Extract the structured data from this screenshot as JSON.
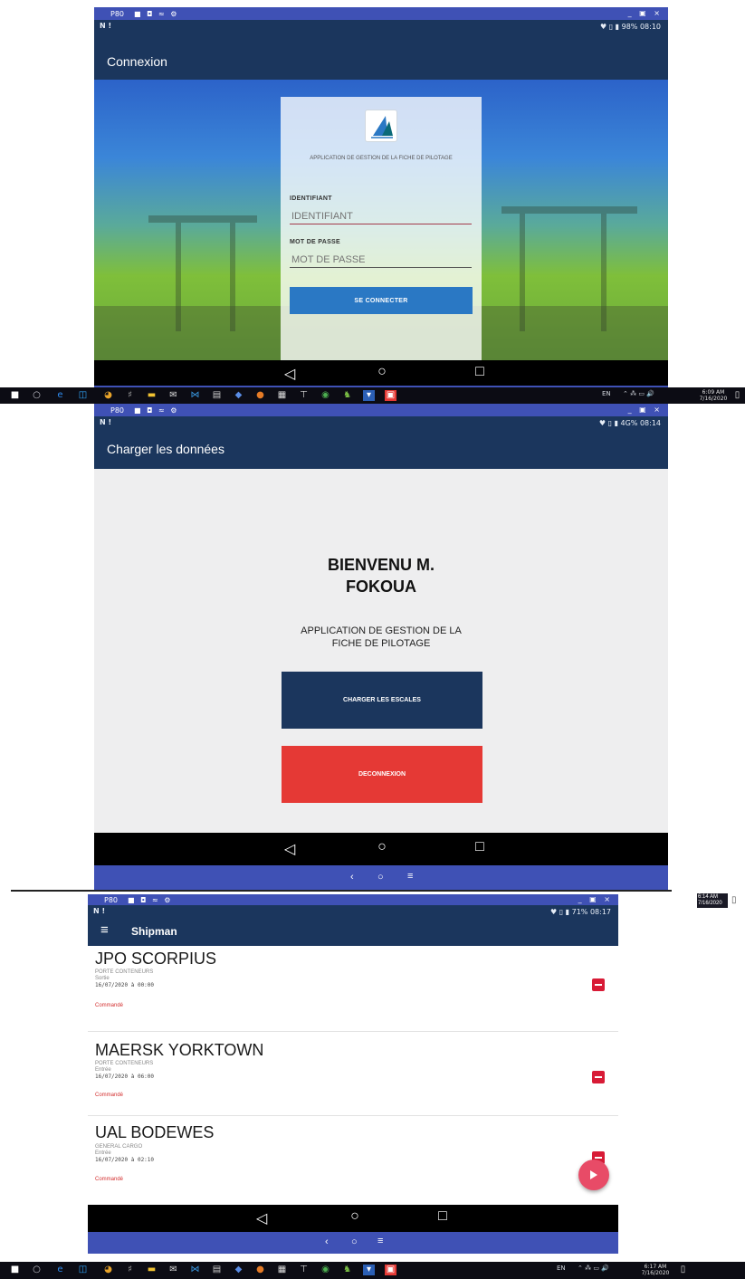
{
  "emulator": {
    "label": "P80",
    "tools": "■ ◘ ≈ ⚙",
    "controls": "_ ▣ ×"
  },
  "status": {
    "left": "N !",
    "right_1": "♥ ▯ ▮ 98% 08:10",
    "right_2": "♥ ▯ ▮ 4G% 08:14",
    "right_3": "♥ ▯ ▮ 71% 08:17"
  },
  "nav_icons": {
    "back": "◁",
    "home": "○",
    "recents": "□",
    "emu_back": "‹",
    "emu_home": "○",
    "emu_menu": "≡"
  },
  "login": {
    "appbar_title": "Connexion",
    "app_name": "APPLICATION DE GESTION DE LA FICHE DE PILOTAGE",
    "id_label": "IDENTIFIANT",
    "id_placeholder": "IDENTIFIANT",
    "pw_label": "MOT DE PASSE",
    "pw_placeholder": "MOT DE PASSE",
    "connect_button": "SE CONNECTER"
  },
  "welcome": {
    "appbar_title": "Charger les données",
    "greeting_line1": "BIENVENU M.",
    "greeting_line2": "FOKOUA",
    "app_line1": "APPLICATION DE GESTION DE LA",
    "app_line2": "FICHE DE PILOTAGE",
    "load_button": "CHARGER LES ESCALES",
    "logout_button": "DECONNEXION"
  },
  "shipman": {
    "appbar_title": "Shipman",
    "ships": [
      {
        "name": "JPO SCORPIUS",
        "type": "PORTE CONTENEURS",
        "movement": "Sortie",
        "date": "16/07/2020 à 00:00",
        "status": "Commandé"
      },
      {
        "name": "MAERSK YORKTOWN",
        "type": "PORTE CONTENEURS",
        "movement": "Entrée",
        "date": "16/07/2020 à 06:00",
        "status": "Commandé"
      },
      {
        "name": "UAL BODEWES",
        "type": "GENERAL CARGO",
        "movement": "Entrée",
        "date": "16/07/2020 à 02:10",
        "status": "Commandé"
      }
    ]
  },
  "taskbar": {
    "lang": "EN",
    "tray": "⌃ ⁂ ▭ 🔊",
    "time1": "6:09 AM",
    "date1": "7/16/2020",
    "time2": "6:14 AM",
    "date2": "7/16/2020",
    "time3": "6:17 AM",
    "date3": "7/16/2020"
  },
  "colors": {
    "primary": "#1b365d",
    "accent_red": "#e53935",
    "emulator": "#3f51b5",
    "button_blue": "#2a78c4"
  }
}
